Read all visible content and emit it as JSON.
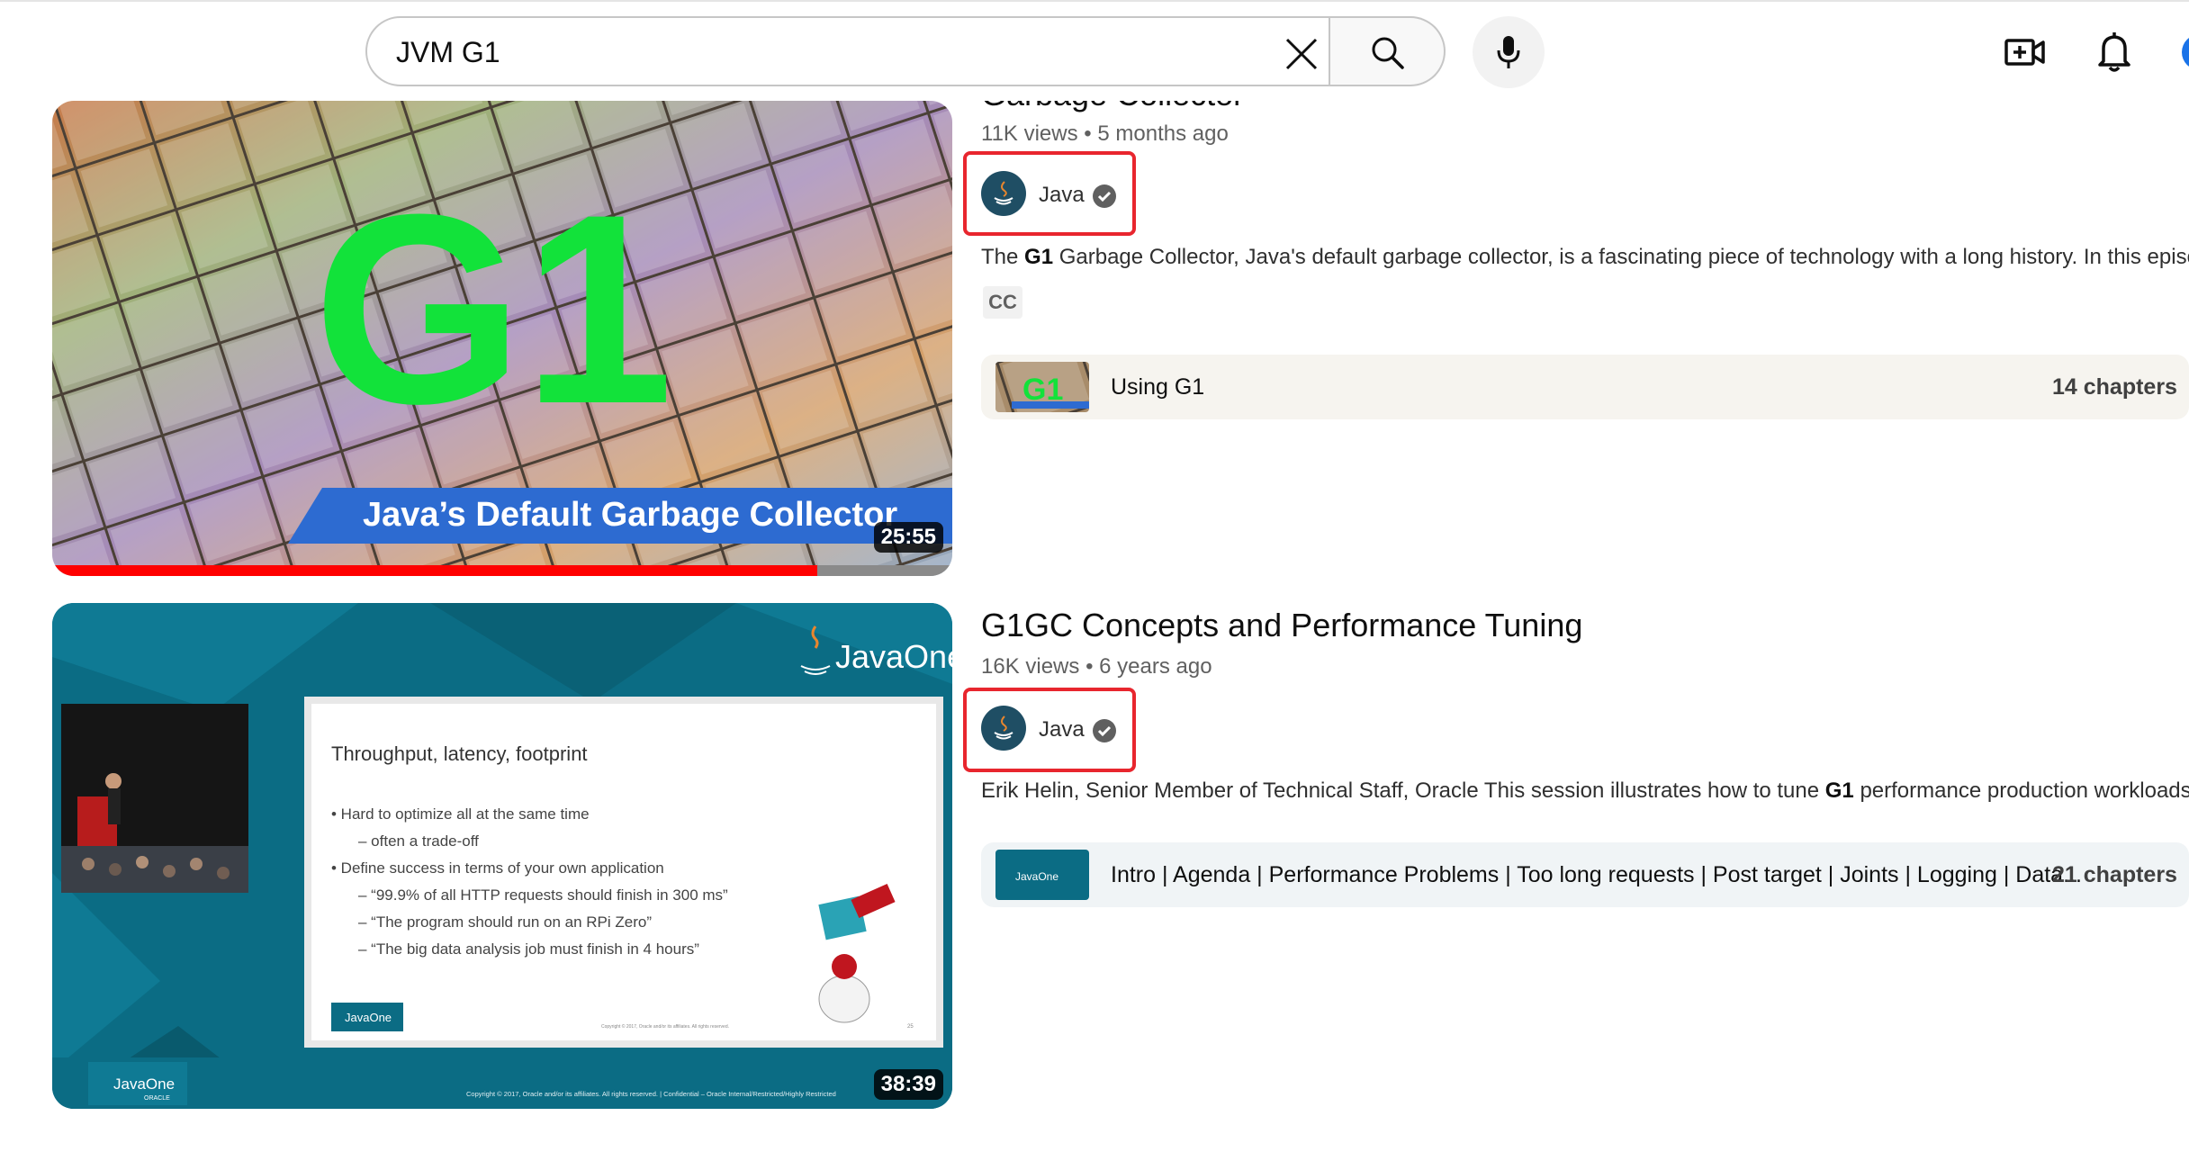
{
  "search": {
    "query": "JVM G1"
  },
  "icons": {
    "clear": "close-icon",
    "search": "search-icon",
    "mic": "microphone-icon",
    "create": "create-video-icon",
    "notifications": "bell-icon"
  },
  "colors": {
    "progress": "#ff0000",
    "highlight": "#e8262e",
    "chapters_bg_1": "#f6f4ef",
    "chapters_bg_2": "#f0f4f6"
  },
  "results": [
    {
      "title": "Garbage Collector",
      "views": "11K views",
      "age": "5 months ago",
      "channel": "Java",
      "description_pre": "The ",
      "description_bold": "G1",
      "description_post": " Garbage Collector, Java's default garbage collector, is a fascinating piece of technology with a long history. In this episo",
      "badge": "CC",
      "duration": "25:55",
      "watch_progress": 0.85,
      "thumb_text_main": "G1",
      "thumb_text_banner": "Java’s Default Garbage Collector",
      "chapter_thumb_text": "G1",
      "chapter_label": "Using G1",
      "chapter_count": "14 chapters"
    },
    {
      "title": "G1GC Concepts and Performance Tuning",
      "views": "16K views",
      "age": "6 years ago",
      "channel": "Java",
      "description_pre": "Erik Helin, Senior Member of Technical Staff, Oracle This session illustrates how to tune ",
      "description_bold": "G1",
      "description_post": " performance production workloads",
      "duration": "38:39",
      "chapter_label": "Intro | Agenda | Performance Problems | Too long requests | Post target | Joints | Logging | Data...",
      "chapter_count": "21 chapters",
      "slide": {
        "brand": "JavaOne",
        "brand_sub": "ORACLE",
        "heading": "Throughput, latency, footprint",
        "bullets": [
          "• Hard to optimize all at the same time",
          "– often a trade-off",
          "• Define success in terms of your own application",
          "– “99.9% of all HTTP requests should finish in 300 ms”",
          "– “The program should run on an RPi Zero”",
          "– “The big data analysis job must finish in 4 hours”"
        ],
        "footer": "Copyright © 2017, Oracle and/or its affiliates. All rights reserved.  |  Confidential – Oracle Internal/Restricted/Highly Restricted",
        "slide_footer": "Copyright © 2017, Oracle and/or its affiliates. All rights reserved.",
        "page_num": "25"
      }
    }
  ]
}
